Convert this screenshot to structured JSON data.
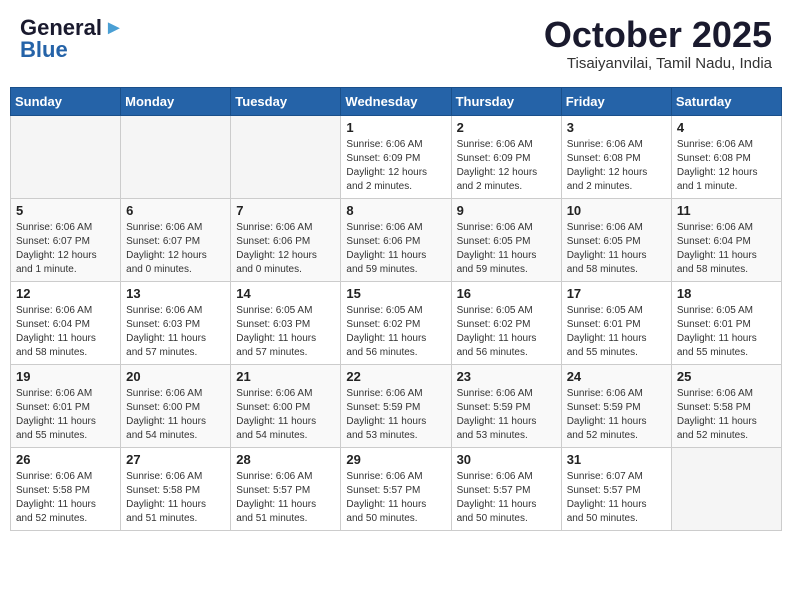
{
  "header": {
    "logo_general": "General",
    "logo_blue": "Blue",
    "title": "October 2025",
    "subtitle": "Tisaiyanvilai, Tamil Nadu, India"
  },
  "weekdays": [
    "Sunday",
    "Monday",
    "Tuesday",
    "Wednesday",
    "Thursday",
    "Friday",
    "Saturday"
  ],
  "weeks": [
    [
      {
        "day": "",
        "info": ""
      },
      {
        "day": "",
        "info": ""
      },
      {
        "day": "",
        "info": ""
      },
      {
        "day": "1",
        "info": "Sunrise: 6:06 AM\nSunset: 6:09 PM\nDaylight: 12 hours\nand 2 minutes."
      },
      {
        "day": "2",
        "info": "Sunrise: 6:06 AM\nSunset: 6:09 PM\nDaylight: 12 hours\nand 2 minutes."
      },
      {
        "day": "3",
        "info": "Sunrise: 6:06 AM\nSunset: 6:08 PM\nDaylight: 12 hours\nand 2 minutes."
      },
      {
        "day": "4",
        "info": "Sunrise: 6:06 AM\nSunset: 6:08 PM\nDaylight: 12 hours\nand 1 minute."
      }
    ],
    [
      {
        "day": "5",
        "info": "Sunrise: 6:06 AM\nSunset: 6:07 PM\nDaylight: 12 hours\nand 1 minute."
      },
      {
        "day": "6",
        "info": "Sunrise: 6:06 AM\nSunset: 6:07 PM\nDaylight: 12 hours\nand 0 minutes."
      },
      {
        "day": "7",
        "info": "Sunrise: 6:06 AM\nSunset: 6:06 PM\nDaylight: 12 hours\nand 0 minutes."
      },
      {
        "day": "8",
        "info": "Sunrise: 6:06 AM\nSunset: 6:06 PM\nDaylight: 11 hours\nand 59 minutes."
      },
      {
        "day": "9",
        "info": "Sunrise: 6:06 AM\nSunset: 6:05 PM\nDaylight: 11 hours\nand 59 minutes."
      },
      {
        "day": "10",
        "info": "Sunrise: 6:06 AM\nSunset: 6:05 PM\nDaylight: 11 hours\nand 58 minutes."
      },
      {
        "day": "11",
        "info": "Sunrise: 6:06 AM\nSunset: 6:04 PM\nDaylight: 11 hours\nand 58 minutes."
      }
    ],
    [
      {
        "day": "12",
        "info": "Sunrise: 6:06 AM\nSunset: 6:04 PM\nDaylight: 11 hours\nand 58 minutes."
      },
      {
        "day": "13",
        "info": "Sunrise: 6:06 AM\nSunset: 6:03 PM\nDaylight: 11 hours\nand 57 minutes."
      },
      {
        "day": "14",
        "info": "Sunrise: 6:05 AM\nSunset: 6:03 PM\nDaylight: 11 hours\nand 57 minutes."
      },
      {
        "day": "15",
        "info": "Sunrise: 6:05 AM\nSunset: 6:02 PM\nDaylight: 11 hours\nand 56 minutes."
      },
      {
        "day": "16",
        "info": "Sunrise: 6:05 AM\nSunset: 6:02 PM\nDaylight: 11 hours\nand 56 minutes."
      },
      {
        "day": "17",
        "info": "Sunrise: 6:05 AM\nSunset: 6:01 PM\nDaylight: 11 hours\nand 55 minutes."
      },
      {
        "day": "18",
        "info": "Sunrise: 6:05 AM\nSunset: 6:01 PM\nDaylight: 11 hours\nand 55 minutes."
      }
    ],
    [
      {
        "day": "19",
        "info": "Sunrise: 6:06 AM\nSunset: 6:01 PM\nDaylight: 11 hours\nand 55 minutes."
      },
      {
        "day": "20",
        "info": "Sunrise: 6:06 AM\nSunset: 6:00 PM\nDaylight: 11 hours\nand 54 minutes."
      },
      {
        "day": "21",
        "info": "Sunrise: 6:06 AM\nSunset: 6:00 PM\nDaylight: 11 hours\nand 54 minutes."
      },
      {
        "day": "22",
        "info": "Sunrise: 6:06 AM\nSunset: 5:59 PM\nDaylight: 11 hours\nand 53 minutes."
      },
      {
        "day": "23",
        "info": "Sunrise: 6:06 AM\nSunset: 5:59 PM\nDaylight: 11 hours\nand 53 minutes."
      },
      {
        "day": "24",
        "info": "Sunrise: 6:06 AM\nSunset: 5:59 PM\nDaylight: 11 hours\nand 52 minutes."
      },
      {
        "day": "25",
        "info": "Sunrise: 6:06 AM\nSunset: 5:58 PM\nDaylight: 11 hours\nand 52 minutes."
      }
    ],
    [
      {
        "day": "26",
        "info": "Sunrise: 6:06 AM\nSunset: 5:58 PM\nDaylight: 11 hours\nand 52 minutes."
      },
      {
        "day": "27",
        "info": "Sunrise: 6:06 AM\nSunset: 5:58 PM\nDaylight: 11 hours\nand 51 minutes."
      },
      {
        "day": "28",
        "info": "Sunrise: 6:06 AM\nSunset: 5:57 PM\nDaylight: 11 hours\nand 51 minutes."
      },
      {
        "day": "29",
        "info": "Sunrise: 6:06 AM\nSunset: 5:57 PM\nDaylight: 11 hours\nand 50 minutes."
      },
      {
        "day": "30",
        "info": "Sunrise: 6:06 AM\nSunset: 5:57 PM\nDaylight: 11 hours\nand 50 minutes."
      },
      {
        "day": "31",
        "info": "Sunrise: 6:07 AM\nSunset: 5:57 PM\nDaylight: 11 hours\nand 50 minutes."
      },
      {
        "day": "",
        "info": ""
      }
    ]
  ]
}
